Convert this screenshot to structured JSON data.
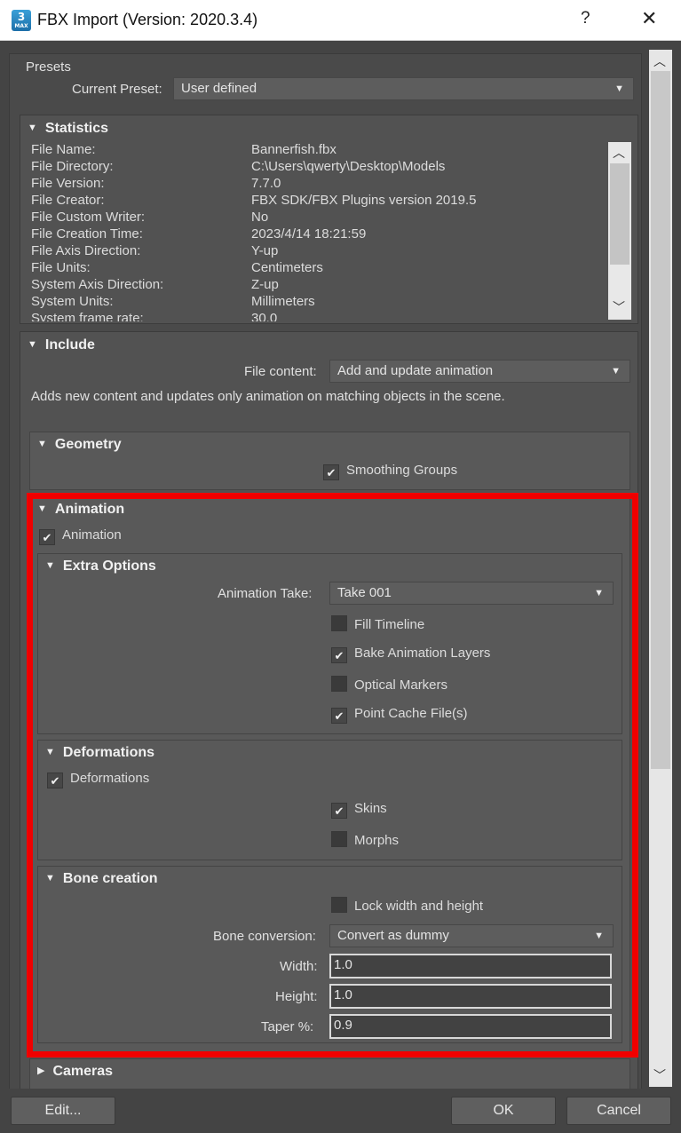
{
  "window": {
    "title": "FBX Import (Version: 2020.3.4)",
    "help_label": "?",
    "close_label": "✕",
    "icon_number": "3",
    "icon_caption": "MAX"
  },
  "presets": {
    "title": "Presets",
    "current_preset_label": "Current Preset:",
    "current_preset_value": "User defined"
  },
  "statistics": {
    "title": "Statistics",
    "rows": [
      {
        "key": "File Name:",
        "value": "Bannerfish.fbx"
      },
      {
        "key": "File Directory:",
        "value": "C:\\Users\\qwerty\\Desktop\\Models"
      },
      {
        "key": "File Version:",
        "value": "7.7.0"
      },
      {
        "key": "File Creator:",
        "value": "FBX SDK/FBX Plugins version 2019.5"
      },
      {
        "key": "File Custom Writer:",
        "value": "No"
      },
      {
        "key": "File Creation Time:",
        "value": "2023/4/14  18:21:59"
      },
      {
        "key": "File Axis Direction:",
        "value": "Y-up"
      },
      {
        "key": "File Units:",
        "value": "Centimeters"
      },
      {
        "key": "System Axis Direction:",
        "value": "Z-up"
      },
      {
        "key": "System Units:",
        "value": "Millimeters"
      },
      {
        "key": "System frame rate:",
        "value": "30.0"
      }
    ]
  },
  "include": {
    "title": "Include",
    "file_content_label": "File content:",
    "file_content_value": "Add and update animation",
    "description": "Adds new content and updates only animation on matching objects in the scene."
  },
  "geometry": {
    "title": "Geometry",
    "smoothing_groups_label": "Smoothing Groups",
    "smoothing_groups_checked": true
  },
  "animation": {
    "title": "Animation",
    "animation_label": "Animation",
    "animation_checked": true,
    "extra_options": {
      "title": "Extra Options",
      "take_label": "Animation Take:",
      "take_value": "Take 001",
      "fill_timeline_label": "Fill Timeline",
      "bake_layers_label": "Bake Animation Layers",
      "optical_markers_label": "Optical Markers",
      "point_cache_label": "Point Cache File(s)"
    },
    "deformations": {
      "title": "Deformations",
      "deformations_label": "Deformations",
      "skins_label": "Skins",
      "morphs_label": "Morphs"
    },
    "bone_creation": {
      "title": "Bone creation",
      "lock_label": "Lock width and height",
      "conversion_label": "Bone conversion:",
      "conversion_value": "Convert as dummy",
      "width_label": "Width:",
      "width_value": "1.0",
      "height_label": "Height:",
      "height_value": "1.0",
      "taper_label": "Taper %:",
      "taper_value": "0.9"
    }
  },
  "cameras": {
    "title": "Cameras"
  },
  "footer": {
    "edit_label": "Edit...",
    "ok_label": "OK",
    "cancel_label": "Cancel"
  },
  "glyphs": {
    "check": "✔",
    "dropdown": "▼",
    "expanded": "▼",
    "collapsed": "▶",
    "scroll_up": "︿",
    "scroll_down": "﹀"
  },
  "colors": {
    "highlight": "#f00000",
    "background": "#444444"
  }
}
